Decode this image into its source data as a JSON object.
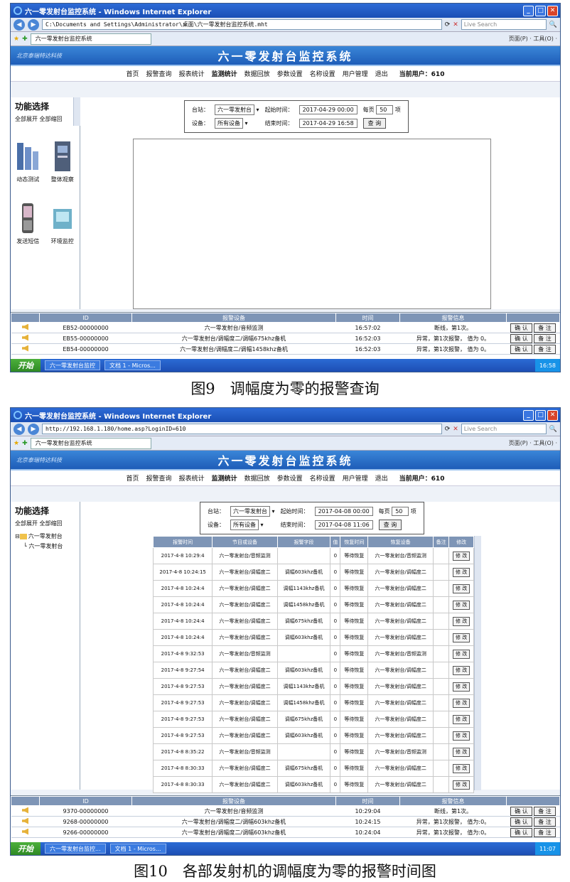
{
  "window": {
    "title": "六一零发射台监控系统 - Windows Internet Explorer",
    "search_placeholder": "Live Search",
    "tools": "页面(P) · 工具(O) ·"
  },
  "app": {
    "title": "六一零发射台监控系统",
    "logo_text": "北京泰瑞特达科技",
    "menu": [
      "首页",
      "报警查询",
      "报表统计",
      "监测统计",
      "数据回放",
      "参数设置",
      "名称设置",
      "用户管理",
      "退出"
    ],
    "active_menu": "监测统计",
    "user_label": "当前用户：610",
    "sidebar_title": "功能选择",
    "expand_label": "全部展开 全部缩回"
  },
  "screen1": {
    "url": "C:\\Documents and Settings\\Administrator\\桌面\\六一零发射台监控系统.mht",
    "tab": "六一零发射台监控系统",
    "sidebar_icons": [
      "动态测试",
      "整体观察",
      "发送短信",
      "环境监控"
    ],
    "query": {
      "station_label": "台站：",
      "station_value": "六一零发射台",
      "start_label": "起始时间：",
      "start_value": "2017-04-29 00:00",
      "per_page_label": "每页",
      "per_page_value": "50",
      "per_page_unit": "项",
      "device_label": "设备：",
      "device_value": "所有设备",
      "end_label": "结束时间：",
      "end_value": "2017-04-29 16:58",
      "query_button": "查 询"
    },
    "alarm_headers": [
      "ID",
      "报警设备",
      "时间",
      "报警信息"
    ],
    "alarms": [
      {
        "id": "EB52-00000000",
        "device": "六一零发射台/音频监测",
        "time": "16:57:02",
        "info": "断线，第1次。"
      },
      {
        "id": "EB55-00000000",
        "device": "六一零发射台/调幅度二/调幅675khz备机",
        "time": "16:52:03",
        "info": "异常，第1次报警， 值为 0。"
      },
      {
        "id": "EB54-00000000",
        "device": "六一零发射台/调幅度二/调幅1458khz备机",
        "time": "16:52:03",
        "info": "异常，第1次报警， 值为 0。"
      }
    ],
    "confirm_label": "确 认",
    "note_label": "备 注",
    "taskbar": {
      "start": "开始",
      "task1": "六一零发射台监控",
      "task2": "文档 1 - Micros...",
      "clock": "16:58"
    }
  },
  "caption1": "图9　调幅度为零的报警查询",
  "screen2": {
    "url": "http://192.168.1.180/home.asp?LoginID=610",
    "tab": "六一零发射台监控系统",
    "tree_root": "六一零发射台",
    "tree_child": "六一零发射台",
    "query": {
      "station_label": "台站：",
      "station_value": "六一零发射台",
      "start_label": "起始时间：",
      "start_value": "2017-04-08 00:00",
      "per_page_label": "每页",
      "per_page_value": "50",
      "per_page_unit": "项",
      "device_label": "设备：",
      "device_value": "所有设备",
      "end_label": "结束时间：",
      "end_value": "2017-04-08 11:06",
      "query_button": "查 询"
    },
    "table_headers": [
      "报警时间",
      "节目或设备",
      "报警字段",
      "值",
      "恢复时间",
      "恢复设备",
      "备注",
      "修改"
    ],
    "rows": [
      {
        "time": "2017-4-8 10:29:4",
        "device": "六一零发射台/音频监测",
        "field": "",
        "value": "0",
        "recover": "等待恢复",
        "rdevice": "六一零发射台/音频监测"
      },
      {
        "time": "2017-4-8 10:24:15",
        "device": "六一零发射台/调幅度二",
        "field": "调幅603khz备机",
        "value": "0",
        "recover": "等待恢复",
        "rdevice": "六一零发射台/调幅度二"
      },
      {
        "time": "2017-4-8 10:24:4",
        "device": "六一零发射台/调幅度二",
        "field": "调幅1143khz备机",
        "value": "0",
        "recover": "等待恢复",
        "rdevice": "六一零发射台/调幅度二"
      },
      {
        "time": "2017-4-8 10:24:4",
        "device": "六一零发射台/调幅度二",
        "field": "调幅1458khz备机",
        "value": "0",
        "recover": "等待恢复",
        "rdevice": "六一零发射台/调幅度二"
      },
      {
        "time": "2017-4-8 10:24:4",
        "device": "六一零发射台/调幅度二",
        "field": "调幅675khz备机",
        "value": "0",
        "recover": "等待恢复",
        "rdevice": "六一零发射台/调幅度二"
      },
      {
        "time": "2017-4-8 10:24:4",
        "device": "六一零发射台/调幅度二",
        "field": "调幅603khz备机",
        "value": "0",
        "recover": "等待恢复",
        "rdevice": "六一零发射台/调幅度二"
      },
      {
        "time": "2017-4-8 9:32:53",
        "device": "六一零发射台/音频监测",
        "field": "",
        "value": "0",
        "recover": "等待恢复",
        "rdevice": "六一零发射台/音频监测"
      },
      {
        "time": "2017-4-8 9:27:54",
        "device": "六一零发射台/调幅度二",
        "field": "调幅603khz备机",
        "value": "0",
        "recover": "等待恢复",
        "rdevice": "六一零发射台/调幅度二"
      },
      {
        "time": "2017-4-8 9:27:53",
        "device": "六一零发射台/调幅度二",
        "field": "调幅1143khz备机",
        "value": "0",
        "recover": "等待恢复",
        "rdevice": "六一零发射台/调幅度二"
      },
      {
        "time": "2017-4-8 9:27:53",
        "device": "六一零发射台/调幅度二",
        "field": "调幅1458khz备机",
        "value": "0",
        "recover": "等待恢复",
        "rdevice": "六一零发射台/调幅度二"
      },
      {
        "time": "2017-4-8 9:27:53",
        "device": "六一零发射台/调幅度二",
        "field": "调幅675khz备机",
        "value": "0",
        "recover": "等待恢复",
        "rdevice": "六一零发射台/调幅度二"
      },
      {
        "time": "2017-4-8 9:27:53",
        "device": "六一零发射台/调幅度二",
        "field": "调幅603khz备机",
        "value": "0",
        "recover": "等待恢复",
        "rdevice": "六一零发射台/调幅度二"
      },
      {
        "time": "2017-4-8 8:35:22",
        "device": "六一零发射台/音频监测",
        "field": "",
        "value": "0",
        "recover": "等待恢复",
        "rdevice": "六一零发射台/音频监测"
      },
      {
        "time": "2017-4-8 8:30:33",
        "device": "六一零发射台/调幅度二",
        "field": "调幅675khz备机",
        "value": "0",
        "recover": "等待恢复",
        "rdevice": "六一零发射台/调幅度二"
      },
      {
        "time": "2017-4-8 8:30:33",
        "device": "六一零发射台/调幅度二",
        "field": "调幅603khz备机",
        "value": "0",
        "recover": "等待恢复",
        "rdevice": "六一零发射台/调幅度二"
      }
    ],
    "edit_label": "修 改",
    "alarm_headers": [
      "ID",
      "报警设备",
      "时间",
      "报警信息"
    ],
    "alarms": [
      {
        "id": "9370-00000000",
        "device": "六一零发射台/音频监测",
        "time": "10:29:04",
        "info": "断线，第1次。"
      },
      {
        "id": "9268-00000000",
        "device": "六一零发射台/调幅度二/调幅603khz备机",
        "time": "10:24:15",
        "info": "异常，第1次报警， 值为:0。"
      },
      {
        "id": "9266-00000000",
        "device": "六一零发射台/调幅度二/调幅603khz备机",
        "time": "10:24:04",
        "info": "异常，第1次报警， 值为:0。"
      }
    ],
    "confirm_label": "确 认",
    "note_label": "备 注",
    "taskbar": {
      "start": "开始",
      "task1": "六一零发射台监控...",
      "task2": "文档 1 - Micros...",
      "clock": "11:07"
    }
  },
  "caption2": "图10　各部发射机的调幅度为零的报警时间图"
}
